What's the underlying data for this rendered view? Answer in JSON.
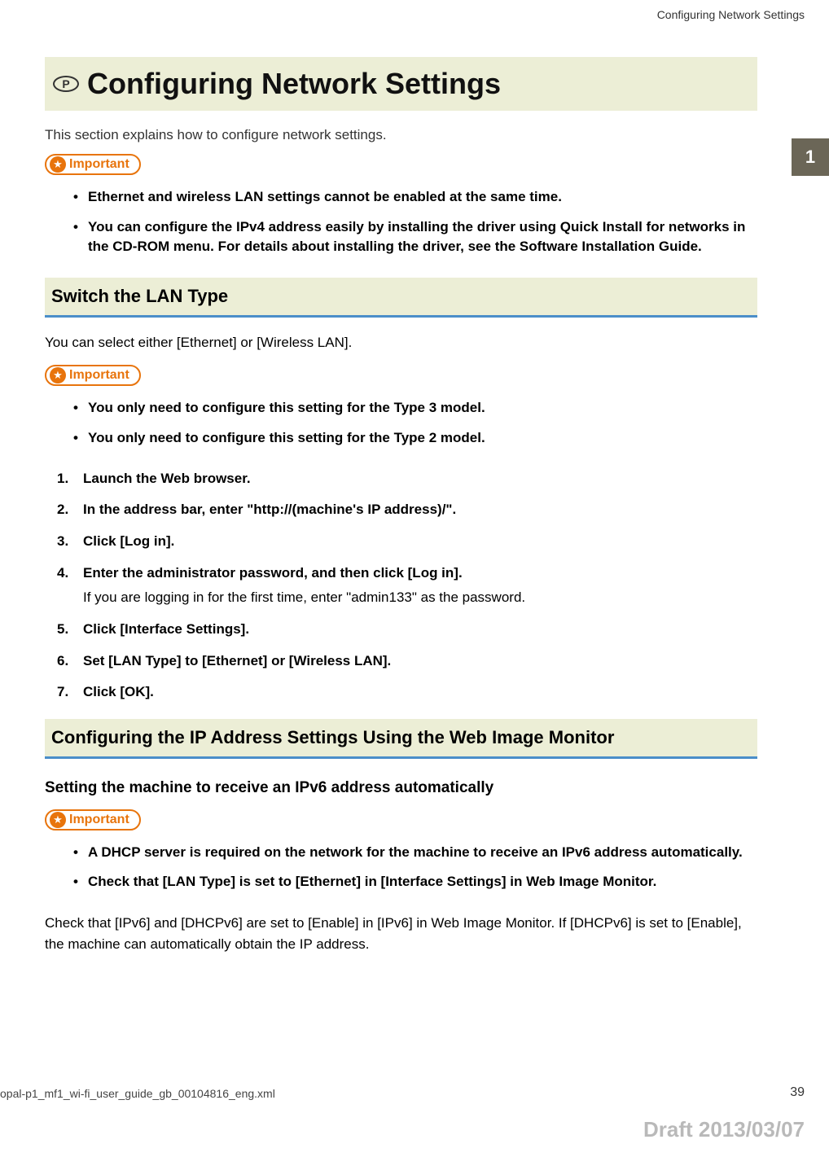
{
  "header": {
    "running_title": "Configuring Network Settings"
  },
  "chapter_tab": "1",
  "title": {
    "icon_letter": "P",
    "text": "Configuring Network Settings"
  },
  "intro_text": "This section explains how to configure network settings.",
  "important_label": "Important",
  "important_block1": {
    "items": [
      "Ethernet and wireless LAN settings cannot be enabled at the same time.",
      "You can configure the IPv4 address easily by installing the driver using Quick Install for networks in the CD-ROM menu. For details about installing the driver, see the Software Installation Guide."
    ]
  },
  "section_lan": {
    "heading": "Switch the LAN Type",
    "intro": "You can select either [Ethernet] or [Wireless LAN].",
    "important_items": [
      "You only need to configure this setting for the Type 3 model.",
      "You only need to configure this setting for the Type 2 model."
    ],
    "steps": [
      {
        "text": "Launch the Web browser."
      },
      {
        "text": "In the address bar, enter \"http://(machine's IP address)/\"."
      },
      {
        "text": "Click [Log in]."
      },
      {
        "text": "Enter the administrator password, and then click [Log in].",
        "sub": "If you are logging in for the first time, enter \"admin133\" as the password."
      },
      {
        "text": "Click [Interface Settings]."
      },
      {
        "text": "Set [LAN Type] to [Ethernet] or [Wireless LAN]."
      },
      {
        "text": "Click [OK]."
      }
    ]
  },
  "section_ip": {
    "heading": "Configuring the IP Address Settings Using the Web Image Monitor",
    "sub_heading": "Setting the machine to receive an IPv6 address automatically",
    "important_items": [
      "A DHCP server is required on the network for the machine to receive an IPv6 address automatically.",
      "Check that [LAN Type] is set to [Ethernet] in [Interface Settings] in Web Image Monitor."
    ],
    "body_text": "Check that [IPv6] and [DHCPv6] are set to [Enable] in [IPv6] in Web Image Monitor. If [DHCPv6] is set to [Enable], the machine can automatically obtain the IP address."
  },
  "footer": {
    "file": "opal-p1_mf1_wi-fi_user_guide_gb_00104816_eng.xml",
    "page": "39",
    "draft": "Draft 2013/03/07"
  }
}
